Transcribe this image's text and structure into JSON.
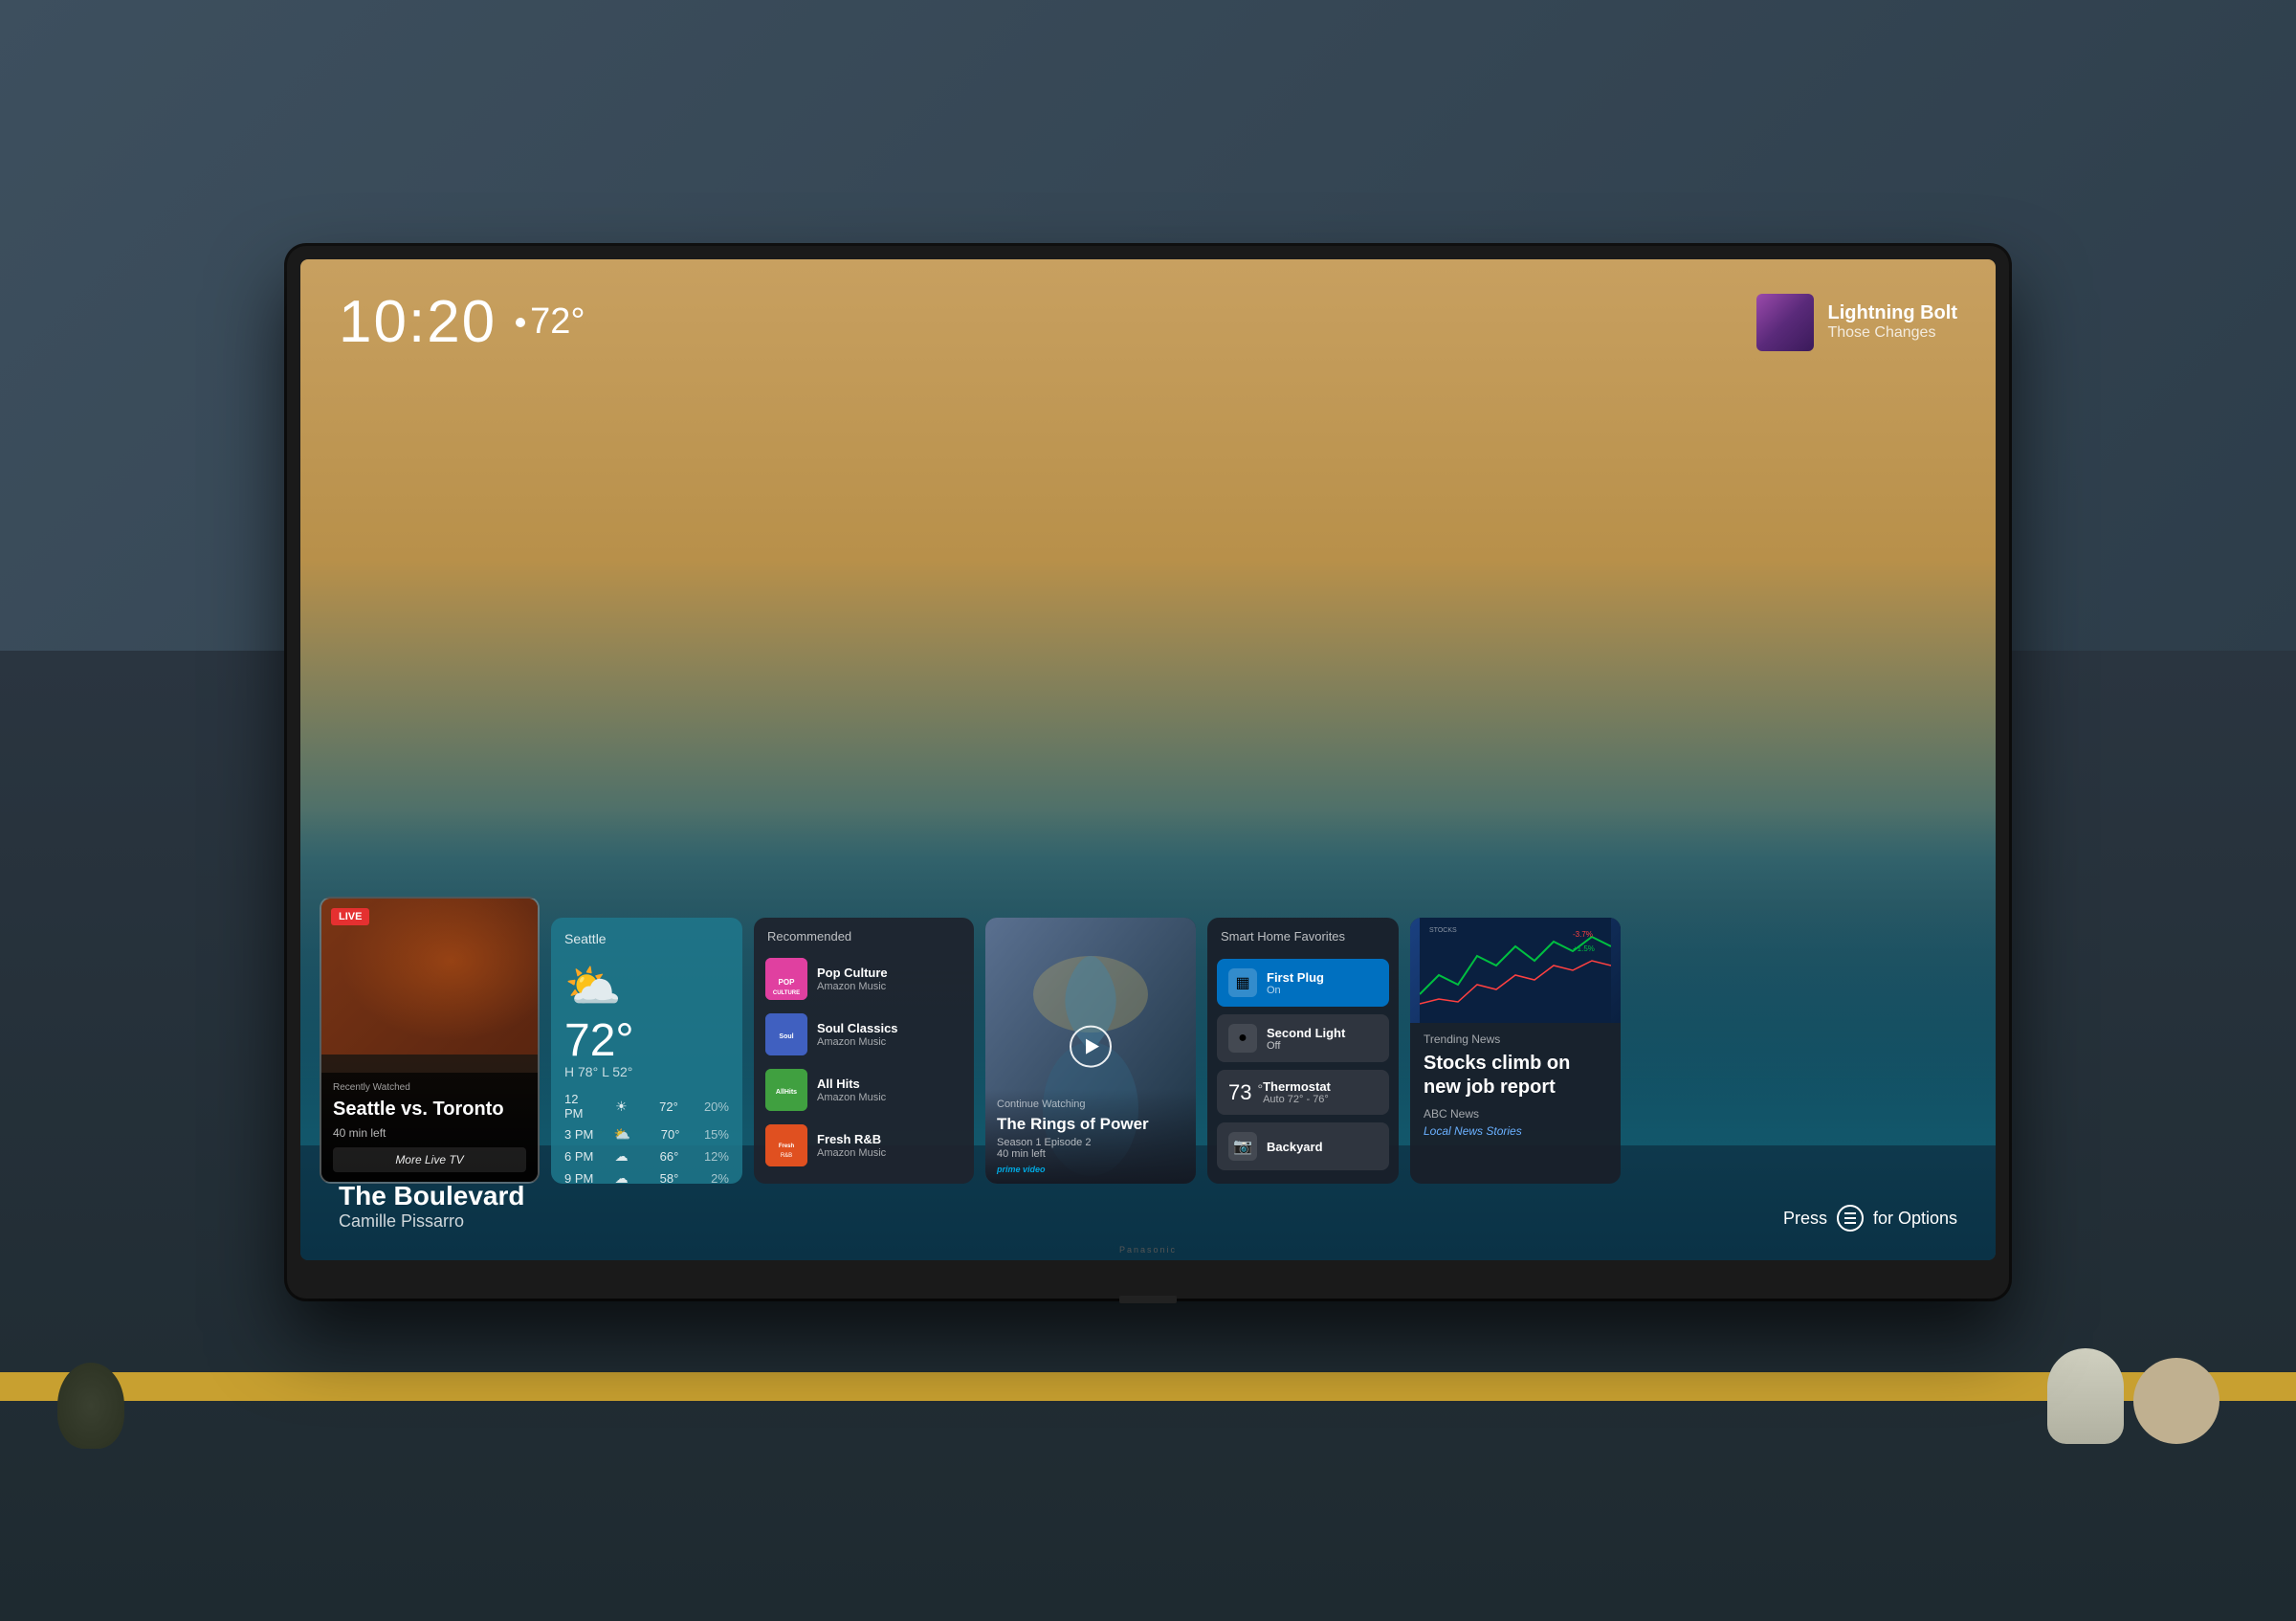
{
  "screen": {
    "time": "10:20",
    "temperature": "72°",
    "artwork": {
      "title": "The Boulevard",
      "artist": "Camille Pissarro"
    },
    "now_playing": {
      "song": "Lightning Bolt",
      "artist": "Those Changes"
    },
    "press_options": "Press",
    "press_options_suffix": "for Options"
  },
  "cards": {
    "recently_watched": {
      "label": "Recently Watched",
      "title": "Seattle vs. Toronto",
      "time_left": "40 min left",
      "link": "More Live TV",
      "live_badge": "LIVE"
    },
    "weather": {
      "city": "Seattle",
      "temp": "72°",
      "high": "H 78°",
      "low": "L 52°",
      "forecast": [
        {
          "time": "12 PM",
          "icon": "☀",
          "temp": "72°",
          "pct": "20%"
        },
        {
          "time": "3 PM",
          "icon": "⛅",
          "temp": "70°",
          "pct": "15%"
        },
        {
          "time": "6 PM",
          "icon": "☁",
          "temp": "66°",
          "pct": "12%"
        },
        {
          "time": "9 PM",
          "icon": "☁",
          "temp": "58°",
          "pct": "2%"
        }
      ]
    },
    "recommended": {
      "label": "Recommended",
      "items": [
        {
          "title": "Pop Culture",
          "source": "Amazon Music",
          "color": "#e040a0"
        },
        {
          "title": "Soul Classics",
          "source": "Amazon Music",
          "color": "#4060c0"
        },
        {
          "title": "All Hits",
          "source": "Amazon Music",
          "color": "#40a040"
        },
        {
          "title": "Fresh R&B",
          "source": "Amazon Music",
          "color": "#e05020"
        }
      ]
    },
    "continue_watching": {
      "label": "Continue Watching",
      "title": "The Rings of Power",
      "episode": "Season 1 Episode 2",
      "time_left": "40 min left",
      "source": "prime video"
    },
    "smart_home": {
      "label": "Smart Home Favorites",
      "items": [
        {
          "name": "First Plug",
          "status": "On",
          "active": true,
          "icon": "▦"
        },
        {
          "name": "Second Light",
          "status": "Off",
          "active": false,
          "icon": "●"
        },
        {
          "name": "Thermostat",
          "temp": "73°",
          "range": "Auto 72° - 76°",
          "active": false
        },
        {
          "name": "Backyard",
          "status": "",
          "active": false,
          "icon": "📷"
        }
      ]
    },
    "trending_news": {
      "label": "Trending News",
      "headline": "Stocks climb on new job report",
      "source": "ABC News",
      "link": "Local News Stories"
    }
  },
  "brand": "Panasonic"
}
